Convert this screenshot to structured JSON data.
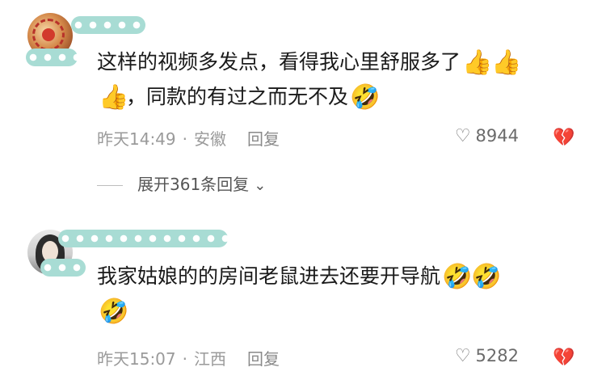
{
  "comments": [
    {
      "text_line1": "这样的视频多发点，看得我心里舒服多了",
      "text_line2": "，同款的有过之而无不及",
      "emojis_line1": [
        "👍",
        "👍"
      ],
      "emojis_line2_prefix": "👍",
      "emojis_line2_suffix": "🤣",
      "time": "昨天14:49",
      "separator": "·",
      "location": "安徽",
      "reply_label": "回复",
      "likes": "8944",
      "expand_label": "展开361条回复"
    },
    {
      "text_line1": "我家姑娘的的房间老鼠进去还要开导航",
      "emojis_line1": [
        "🤣",
        "🤣"
      ],
      "emojis_line2_prefix": "🤣",
      "time": "昨天15:07",
      "separator": "·",
      "location": "江西",
      "reply_label": "回复",
      "likes": "5282"
    }
  ],
  "icons": {
    "heart": "♡",
    "dislike": "💔",
    "chevron": "⌄"
  },
  "colors": {
    "mask": "#a8dcd4",
    "meta_text": "#9a9a9a"
  }
}
